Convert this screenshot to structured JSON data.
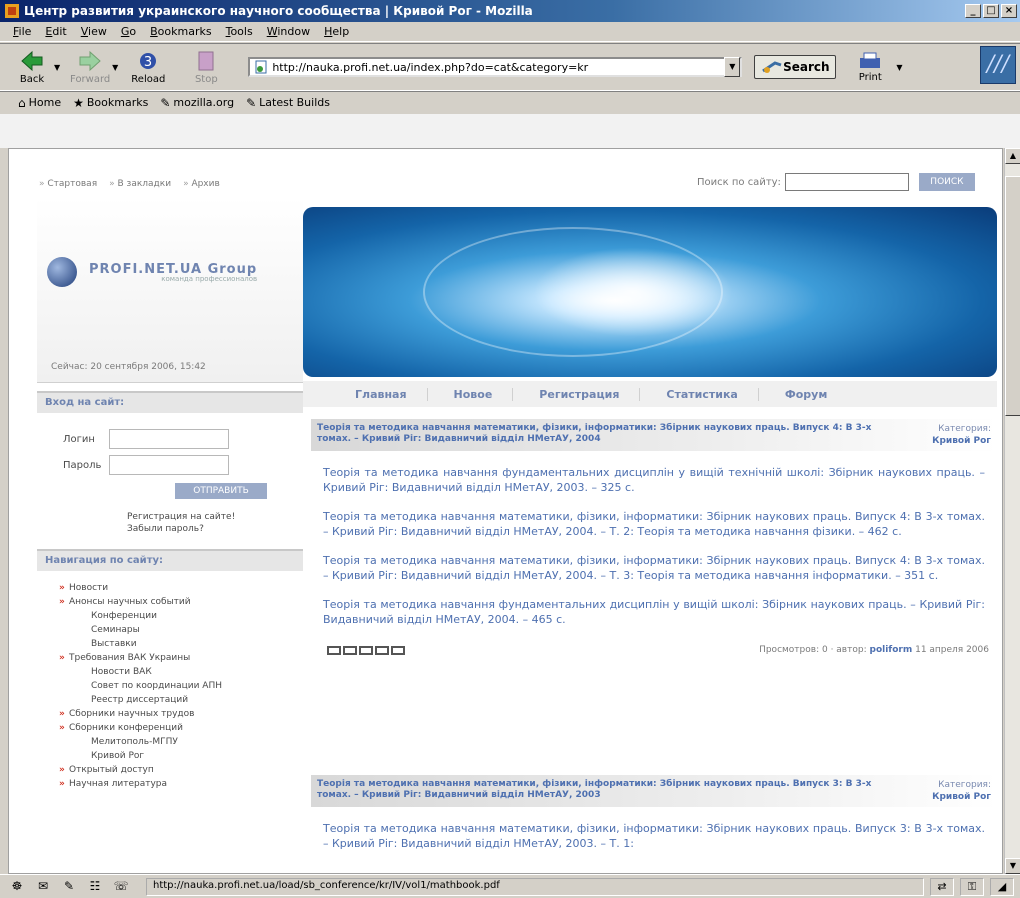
{
  "window": {
    "title": "Центр развития украинского научного сообщества | Кривой Рог - Mozilla"
  },
  "menu": [
    "File",
    "Edit",
    "View",
    "Go",
    "Bookmarks",
    "Tools",
    "Window",
    "Help"
  ],
  "toolbar": {
    "back": "Back",
    "forward": "Forward",
    "reload": "Reload",
    "stop": "Stop",
    "url": "http://nauka.profi.net.ua/index.php?do=cat&category=kr",
    "search": "Search",
    "print": "Print"
  },
  "personal_bar": [
    "Home",
    "Bookmarks",
    "mozilla.org",
    "Latest Builds"
  ],
  "status": {
    "text": "http://nauka.profi.net.ua/load/sb_conference/kr/IV/vol1/mathbook.pdf"
  },
  "site": {
    "top_links": [
      "Стартовая",
      "В закладки",
      "Архив"
    ],
    "search_label": "Поиск по сайту:",
    "search_button": "ПОИСК",
    "logo_title": "PROFI.NET.UA Group",
    "logo_sub": "команда профессионалов",
    "now": "Сейчас: 20 сентября 2006, 15:42",
    "login": {
      "header": "Вход на сайт:",
      "login_label": "Логин",
      "password_label": "Пароль",
      "submit": "ОТПРАВИТЬ",
      "register": "Регистрация на сайте!",
      "forgot": "Забыли пароль?"
    },
    "nav": {
      "header": "Навигация по сайту:",
      "items": [
        {
          "label": "Новости",
          "level": 1
        },
        {
          "label": "Анонсы научных событий",
          "level": 1
        },
        {
          "label": "Конференции",
          "level": 2
        },
        {
          "label": "Семинары",
          "level": 2
        },
        {
          "label": "Выставки",
          "level": 2
        },
        {
          "label": "Требования ВАК Украины",
          "level": 1
        },
        {
          "label": "Новости ВАК",
          "level": 2
        },
        {
          "label": "Совет по координации АПН",
          "level": 2
        },
        {
          "label": "Реестр диссертаций",
          "level": 2
        },
        {
          "label": "Сборники научных трудов",
          "level": 1
        },
        {
          "label": "Сборники конференций",
          "level": 1
        },
        {
          "label": "Мелитополь-МГПУ",
          "level": 2
        },
        {
          "label": "Кривой Рог",
          "level": 2
        },
        {
          "label": "Открытый доступ",
          "level": 1
        },
        {
          "label": "Научная литература",
          "level": 1
        }
      ]
    },
    "tabs": [
      "Главная",
      "Новое",
      "Регистрация",
      "Статистика",
      "Форум"
    ],
    "articles": [
      {
        "title": "Теорія та методика навчання математики, фізики, інформатики: Збірник наукових праць. Випуск 4: В 3-х томах. – Кривий Ріг: Видавничий відділ НМетАУ, 2004",
        "category_label": "Категория:",
        "category": "Кривой Рог",
        "items": [
          "Теорія та методика навчання фундаментальних дисциплін у вищій технічній школі: Збірник наукових праць. – Кривий Ріг: Видавничий відділ НМетАУ, 2003. – 325 с.",
          "Теорія та методика навчання математики, фізики, інформатики: Збірник наукових праць. Випуск 4: В 3-х томах. – Кривий Ріг: Видавничий відділ НМетАУ, 2004. – Т. 2: Теорія та методика навчання фізики. – 462 с.",
          "Теорія та методика навчання математики, фізики, інформатики: Збірник наукових праць. Випуск 4: В 3-х томах. – Кривий Ріг: Видавничий відділ НМетАУ, 2004. – Т. 3: Теорія та методика навчання інформатики. – 351 с.",
          "Теорія та методика навчання фундаментальних дисциплін у вищій школі: Збірник наукових праць. – Кривий Ріг: Видавничий відділ НМетАУ, 2004. – 465 с."
        ],
        "views": "Просмотров: 0",
        "author_label": "автор:",
        "author": "poliform",
        "date": "11 апреля 2006"
      },
      {
        "title": "Теорія та методика навчання математики, фізики, інформатики: Збірник наукових праць. Випуск 3: В 3-х томах. – Кривий Ріг: Видавничий відділ НМетАУ, 2003",
        "category_label": "Категория:",
        "category": "Кривой Рог",
        "items": [
          "Теорія та методика навчання математики, фізики, інформатики: Збірник наукових праць. Випуск 3: В 3-х томах. – Кривий Ріг: Видавничий відділ НМетАУ, 2003. – Т. 1:"
        ]
      }
    ]
  },
  "icons": {
    "back": "back-arrow-icon",
    "forward": "forward-arrow-icon",
    "reload": "reload-icon",
    "stop": "stop-icon",
    "print": "printer-icon",
    "search": "search-icon"
  }
}
